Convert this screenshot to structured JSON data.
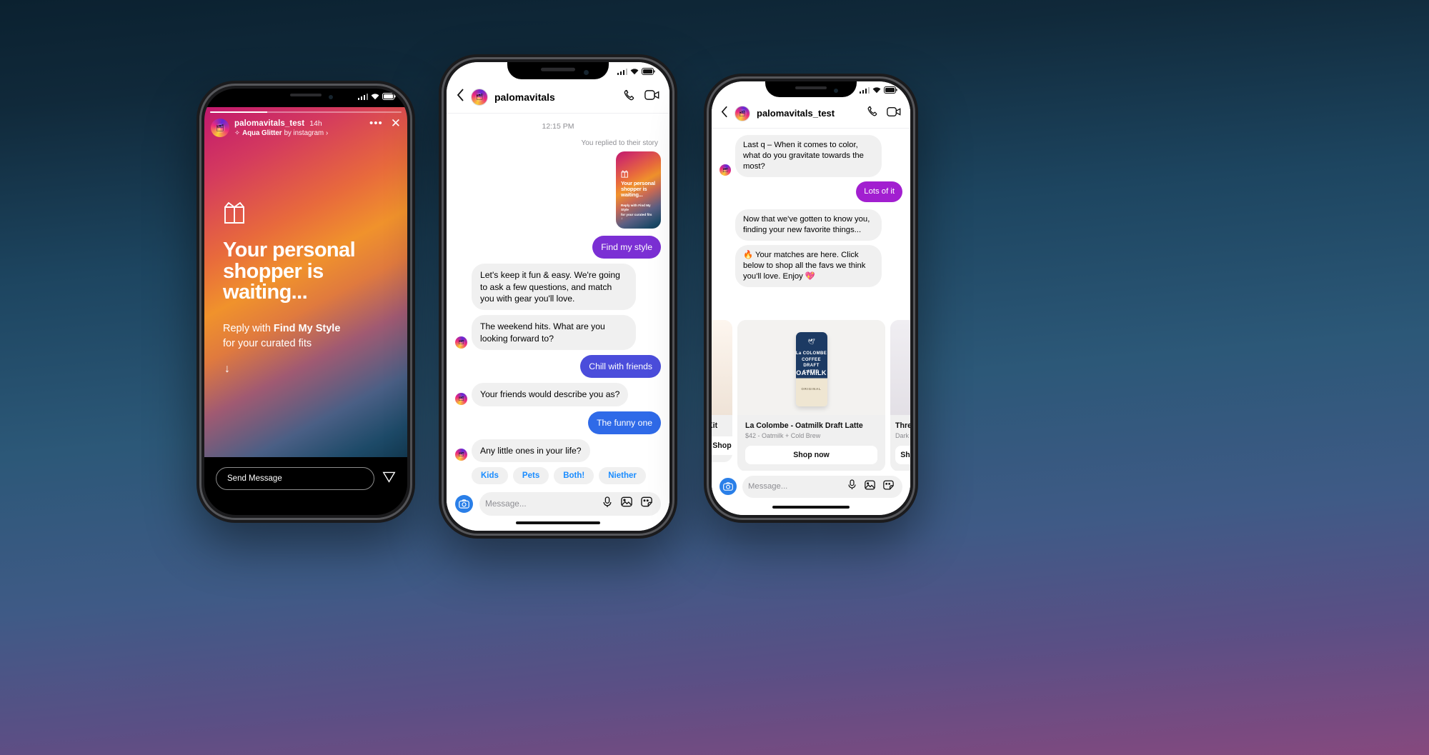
{
  "background": {
    "from": "#0b2130",
    "mid": "#2c5878",
    "to": "#86497e"
  },
  "phone_story": {
    "status": {
      "signal": "signal-bars",
      "wifi": "wifi",
      "battery": "battery"
    },
    "story": {
      "username": "palomavitals_test",
      "timestamp": "14h",
      "music_sticker": "Aqua Glitter",
      "music_by": "by instagram",
      "music_chevron": "›",
      "more_icon": "•••",
      "close_icon": "✕",
      "gift_icon": "gift-icon",
      "headline": "Your personal shopper is waiting...",
      "subline_prefix": "Reply with ",
      "subline_bold": "Find My Style",
      "subline_suffix": "for your curated fits",
      "arrow": "↓"
    },
    "composer": {
      "placeholder": "Send Message",
      "send_icon": "send-icon"
    }
  },
  "phone_dm": {
    "header": {
      "back_icon": "back-chevron-icon",
      "name": "palomavitals",
      "call_icon": "phone-icon",
      "video_icon": "video-icon"
    },
    "timestamp": "12:15 PM",
    "reply_note": "You replied to their story",
    "story_reply_card": {
      "gift_icon": "gift-icon",
      "headline": "Your personal shopper is waiting...",
      "subline_prefix": "Reply with ",
      "subline_bold": "Find My Style",
      "subline_suffix": "for your curated fits",
      "arrow": "↓"
    },
    "messages": [
      {
        "side": "out",
        "text": "Find my style",
        "color": "#7b2fd4"
      },
      {
        "side": "in",
        "text": "Let's keep it fun & easy. We're going to ask a few questions, and match you with gear you'll love.",
        "avatar": false
      },
      {
        "side": "in",
        "text": "The weekend hits. What are you looking forward to?",
        "avatar": true
      },
      {
        "side": "out",
        "text": "Chill with friends",
        "color": "#4b4ddb"
      },
      {
        "side": "in",
        "text": "Your friends would describe you as?",
        "avatar": true
      },
      {
        "side": "out",
        "text": "The funny one",
        "color": "#2f6ae8"
      },
      {
        "side": "in",
        "text": "Any little ones in your life?",
        "avatar": true
      }
    ],
    "quick_replies": [
      "Kids",
      "Pets",
      "Both!",
      "Niether"
    ],
    "composer": {
      "camera_icon": "camera-icon",
      "placeholder": "Message...",
      "mic_icon": "mic-icon",
      "gallery_icon": "gallery-icon",
      "sticker_icon": "sticker-icon"
    }
  },
  "phone_products": {
    "header": {
      "back_icon": "back-chevron-icon",
      "name": "palomavitals_test",
      "call_icon": "phone-icon",
      "video_icon": "video-icon"
    },
    "messages": [
      {
        "side": "in",
        "text": "Last q – When it comes to color, what do you gravitate towards the most?",
        "avatar": true
      },
      {
        "side": "out",
        "text": "Lots of it",
        "color": "#a21fd0"
      },
      {
        "side": "in",
        "text": "Now that we've gotten to know you, finding your new favorite things...",
        "avatar": false
      },
      {
        "side": "in",
        "text": "🔥 Your matches are here. Click below to shop all the favs we think you'll love. Enjoy 💖",
        "avatar": false
      }
    ],
    "carousel": [
      {
        "name": "Kit",
        "meta": "",
        "cta": "Shop now",
        "partial": "left"
      },
      {
        "name": "La Colombe - Oatmilk Draft Latte",
        "meta": "$42 - Oatmilk + Cold Brew",
        "cta": "Shop now",
        "partial": "none",
        "product_art": {
          "brand": "La COLOMBE",
          "line1": "COFFEE",
          "line2": "DRAFT LATTE",
          "flavor": "OATMILK",
          "variant": "ORIGINAL"
        }
      },
      {
        "name": "Thre",
        "meta": "Dark",
        "cta": "Shop now",
        "partial": "right"
      }
    ],
    "composer": {
      "camera_icon": "camera-icon",
      "placeholder": "Message...",
      "mic_icon": "mic-icon",
      "gallery_icon": "gallery-icon",
      "sticker_icon": "sticker-icon"
    }
  }
}
